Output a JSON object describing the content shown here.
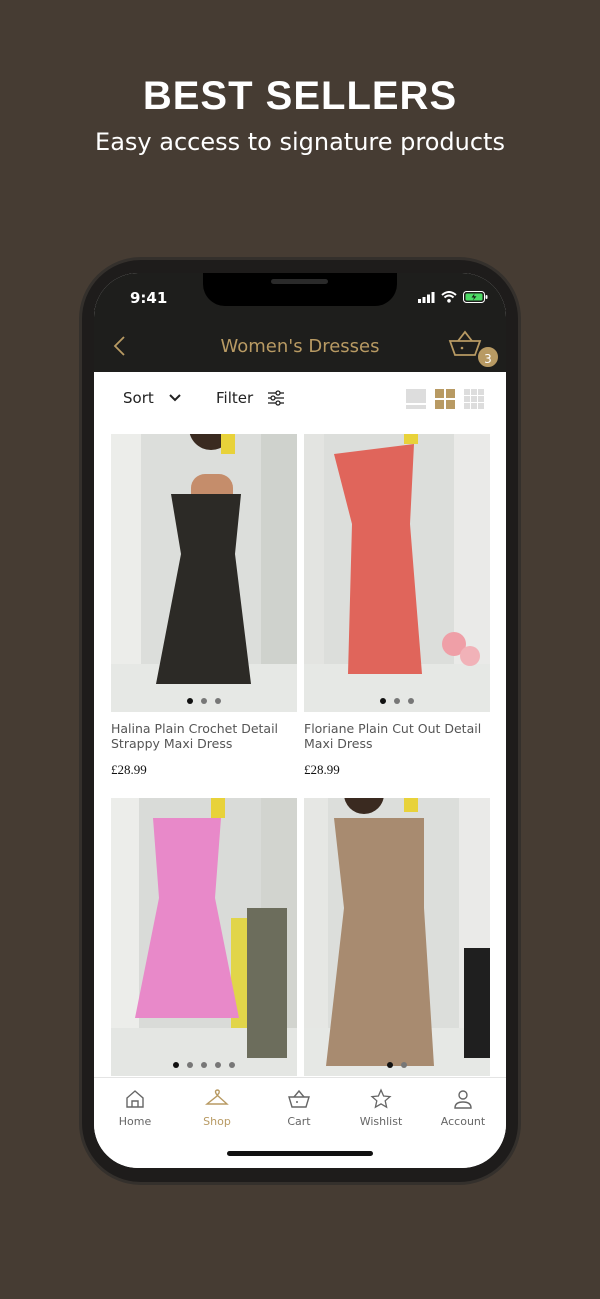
{
  "promo": {
    "title": "BEST SELLERS",
    "subtitle": "Easy access to signature products"
  },
  "status_bar": {
    "time": "9:41"
  },
  "nav": {
    "title": "Women's Dresses",
    "basket_count": "3"
  },
  "toolbar": {
    "sort_label": "Sort",
    "filter_label": "Filter"
  },
  "products": [
    {
      "name": "Halina Plain Crochet Detail Strappy Maxi Dress",
      "price": "£28.99",
      "dots": 3,
      "active_dot": 0,
      "dress_color": "#2c2a26"
    },
    {
      "name": "Floriane Plain Cut Out Detail Maxi Dress",
      "price": "£28.99",
      "dots": 3,
      "active_dot": 0,
      "dress_color": "#e0655b"
    },
    {
      "name": "",
      "price": "",
      "dots": 5,
      "active_dot": 0,
      "dress_color": "#e889c9"
    },
    {
      "name": "",
      "price": "",
      "dots": 2,
      "active_dot": 0,
      "dress_color": "#a88b70"
    }
  ],
  "tabs": [
    {
      "label": "Home",
      "icon": "home-icon",
      "active": false
    },
    {
      "label": "Shop",
      "icon": "hanger-icon",
      "active": true
    },
    {
      "label": "Cart",
      "icon": "basket-icon",
      "active": false
    },
    {
      "label": "Wishlist",
      "icon": "star-icon",
      "active": false
    },
    {
      "label": "Account",
      "icon": "person-icon",
      "active": false
    }
  ],
  "colors": {
    "accent": "#b89a63",
    "background": "#463c33",
    "header": "#1e1e1c"
  }
}
